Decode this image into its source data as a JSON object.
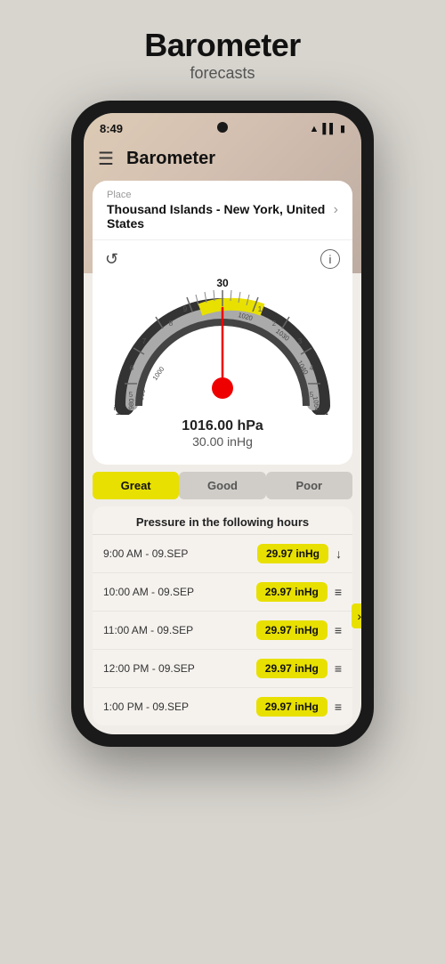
{
  "header": {
    "title": "Barometer",
    "subtitle": "forecasts"
  },
  "status_bar": {
    "time": "8:49",
    "clock_icon": "clock",
    "wifi_icon": "wifi",
    "signal_icon": "signal",
    "battery_icon": "battery"
  },
  "app_bar": {
    "menu_icon": "≡",
    "title": "Barometer"
  },
  "place": {
    "label": "Place",
    "name": "Thousand Islands - New York, United States"
  },
  "gauge": {
    "hpa_reading": "1016.00 hPa",
    "inhg_reading": "30.00 inHg",
    "center_value": "30",
    "left_label": "inHg\n29",
    "right_label": "31"
  },
  "tabs": [
    {
      "label": "Great",
      "active": true
    },
    {
      "label": "Good",
      "active": false
    },
    {
      "label": "Poor",
      "active": false
    }
  ],
  "forecast": {
    "title": "Pressure in the following hours",
    "rows": [
      {
        "time": "9:00 AM - 09.SEP",
        "value": "29.97 inHg",
        "trend": "↓"
      },
      {
        "time": "10:00 AM - 09.SEP",
        "value": "29.97 inHg",
        "trend": "="
      },
      {
        "time": "11:00 AM - 09.SEP",
        "value": "29.97 inHg",
        "trend": "="
      },
      {
        "time": "12:00 PM - 09.SEP",
        "value": "29.97 inHg",
        "trend": "="
      },
      {
        "time": "1:00 PM - 09.SEP",
        "value": "29.97 inHg",
        "trend": "="
      }
    ]
  },
  "icons": {
    "menu": "☰",
    "info": "i",
    "refresh": "↺",
    "chevron_right": "›",
    "expand": "›"
  }
}
